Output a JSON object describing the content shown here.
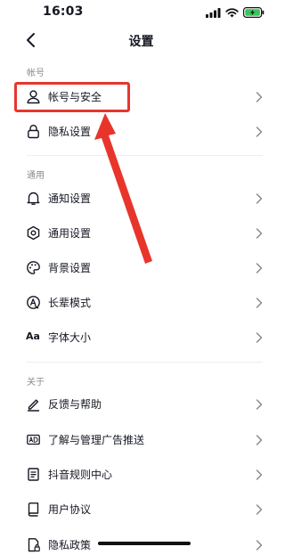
{
  "status_bar": {
    "time": "16:03"
  },
  "nav": {
    "title": "设置"
  },
  "sections": {
    "account": "帐号",
    "general": "通用",
    "about": "关于"
  },
  "rows": {
    "account_security": "帐号与安全",
    "privacy_settings": "隐私设置",
    "notification_settings": "通知设置",
    "general_settings": "通用设置",
    "background_settings": "背景设置",
    "elder_mode": "长辈模式",
    "font_size": "字体大小",
    "feedback_help": "反馈与帮助",
    "ad_management": "了解与管理广告推送",
    "douyin_rules": "抖音规则中心",
    "user_agreement": "用户协议",
    "privacy_policy": "隐私政策"
  },
  "icons": {
    "aa_glyph": "Aa"
  },
  "colors": {
    "annotation": "#e8352c",
    "battery": "#34c759",
    "text": "#161823",
    "muted": "#8a8b91"
  }
}
